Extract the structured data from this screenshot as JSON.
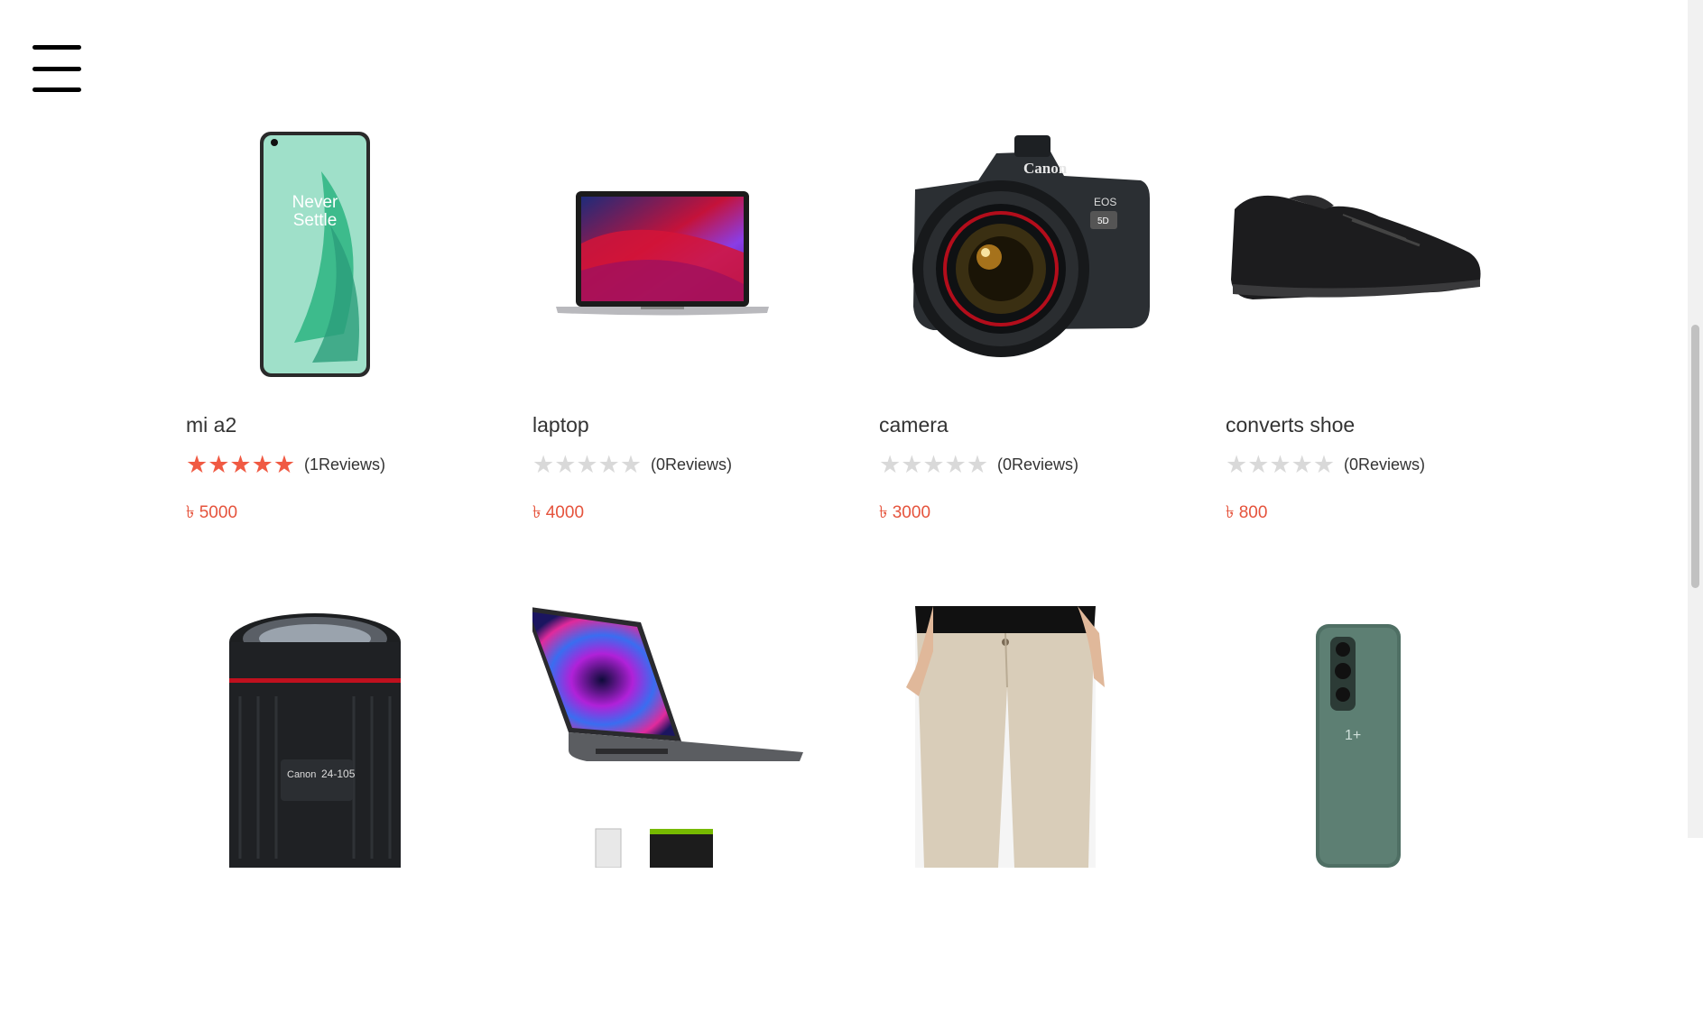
{
  "menu": {
    "icon": "hamburger-menu-icon"
  },
  "products_row1": [
    {
      "name": "mi a2",
      "rating": 5,
      "reviews": "(1Reviews)",
      "price": "৳ 5000",
      "image": "phone-image"
    },
    {
      "name": "laptop",
      "rating": 0,
      "reviews": "(0Reviews)",
      "price": "৳ 4000",
      "image": "laptop-image"
    },
    {
      "name": "camera",
      "rating": 0,
      "reviews": "(0Reviews)",
      "price": "৳ 3000",
      "image": "camera-image"
    },
    {
      "name": "converts shoe",
      "rating": 0,
      "reviews": "(0Reviews)",
      "price": "৳ 800",
      "image": "shoe-image"
    }
  ],
  "products_row2": [
    {
      "image": "camera-lens-image"
    },
    {
      "image": "laptop-image"
    },
    {
      "image": "pants-image"
    },
    {
      "image": "phone-image"
    }
  ],
  "colors": {
    "accent": "#e5533c",
    "star_on": "#f05a43",
    "star_off": "#d9d9d9"
  }
}
